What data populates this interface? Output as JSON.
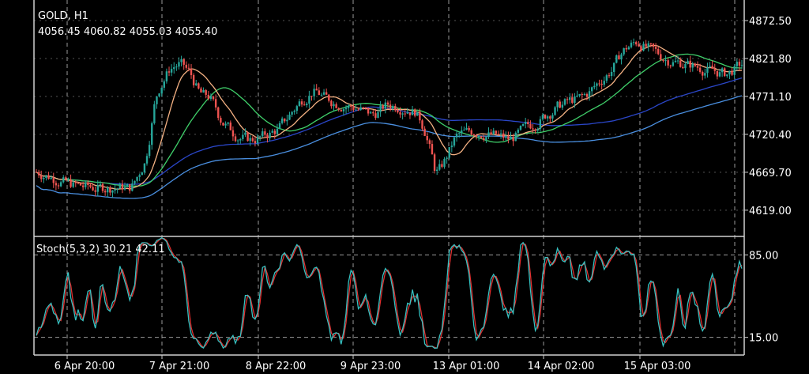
{
  "header": {
    "symbol": "GOLD, H1",
    "ohlc": "4056.45 4060.82 4055.03 4055.40"
  },
  "stoch": {
    "label": "Stoch(5,3,2) 30.21 42.11"
  },
  "chart_data": {
    "type": "candlestick",
    "price_axis": {
      "ticks": [
        "4872.50",
        "4821.80",
        "4771.10",
        "4720.40",
        "4669.70",
        "4619.00"
      ],
      "range": [
        4585,
        4900
      ]
    },
    "stoch_axis": {
      "ticks": [
        "85.00",
        "15.00"
      ],
      "range": [
        0,
        100
      ]
    },
    "x_ticks": [
      "6 Apr 20:00",
      "7 Apr 21:00",
      "8 Apr 22:00",
      "9 Apr 23:00",
      "13 Apr 01:00",
      "14 Apr 02:00",
      "15 Apr 03:00"
    ],
    "colors": {
      "bull": "#26a69a",
      "bear": "#ef5350",
      "ma_fast": "#f4b183",
      "ma_mid": "#3fcf6a",
      "ma_slow": "#2a46c8",
      "ma_slowest": "#4a8fe0",
      "stoch_main": "#37c1c1",
      "stoch_signal": "#e03030",
      "grid": "#9a9a9a"
    }
  }
}
